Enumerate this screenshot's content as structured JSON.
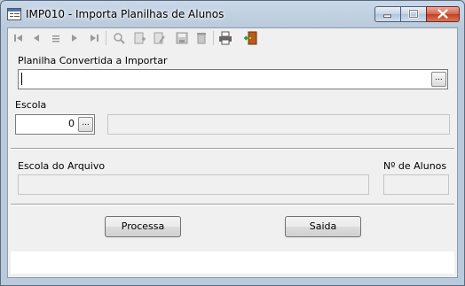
{
  "window": {
    "title": "IMP010 - Importa Planilhas de Alunos",
    "icon": "form-window-icon"
  },
  "toolbar": {
    "items": [
      {
        "name": "first-record-icon"
      },
      {
        "name": "previous-record-icon"
      },
      {
        "name": "list-icon"
      },
      {
        "name": "next-record-icon"
      },
      {
        "name": "last-record-icon"
      },
      {
        "name": "search-icon"
      },
      {
        "name": "new-record-icon"
      },
      {
        "name": "edit-record-icon"
      },
      {
        "name": "save-icon"
      },
      {
        "name": "delete-icon"
      },
      {
        "name": "print-icon"
      },
      {
        "name": "exit-door-icon"
      }
    ]
  },
  "form": {
    "planilha_label": "Planilha Convertida a Importar",
    "planilha_value": "",
    "browse_label": "...",
    "escola_label": "Escola",
    "escola_code": "0",
    "escola_name": "",
    "escola_arquivo_label": "Escola do Arquivo",
    "escola_arquivo_value": "",
    "num_alunos_label": "Nº de Alunos",
    "num_alunos_value": ""
  },
  "actions": {
    "processa_label": "Processa",
    "saida_label": "Saida"
  },
  "status": {
    "text": ""
  }
}
